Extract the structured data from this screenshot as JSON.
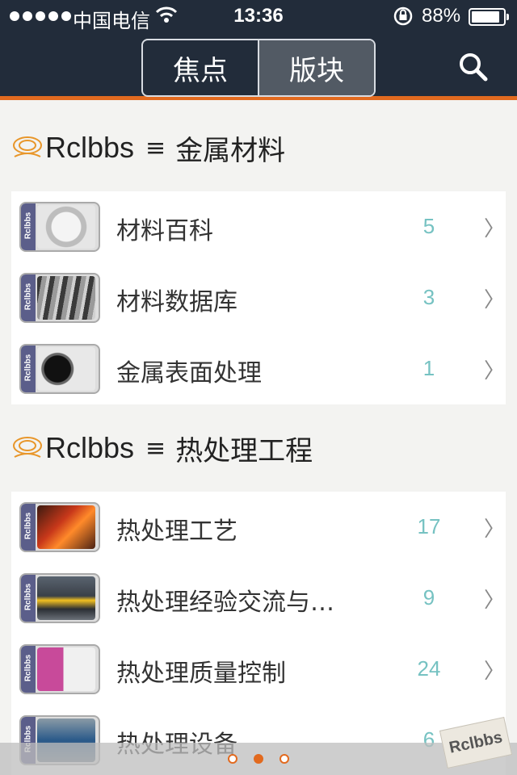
{
  "status_bar": {
    "carrier": "中国电信",
    "time": "13:36",
    "battery": "88%"
  },
  "nav": {
    "tabs": [
      {
        "label": "焦点",
        "active": false
      },
      {
        "label": "版块",
        "active": true
      }
    ],
    "search_icon": "search-icon"
  },
  "sections": [
    {
      "brand": "Rclbbs",
      "separator": "≡",
      "title": "金属材料",
      "items": [
        {
          "title": "材料百科",
          "count": "5"
        },
        {
          "title": "材料数据库",
          "count": "3"
        },
        {
          "title": "金属表面处理",
          "count": "1"
        }
      ]
    },
    {
      "brand": "Rclbbs",
      "separator": "≡",
      "title": "热处理工程",
      "items": [
        {
          "title": "热处理工艺",
          "count": "17"
        },
        {
          "title": "热处理经验交流与…",
          "count": "9"
        },
        {
          "title": "热处理质量控制",
          "count": "24"
        },
        {
          "title": "热处理设备",
          "count": "6"
        }
      ]
    }
  ],
  "thumb_label": "Rclbbs",
  "chevron": "〉",
  "pager": {
    "pages": 3,
    "current": 2
  },
  "watermark": "Rclbbs",
  "colors": {
    "navbar": "#222c3a",
    "accent": "#e26a1f",
    "count": "#76c2c2"
  }
}
